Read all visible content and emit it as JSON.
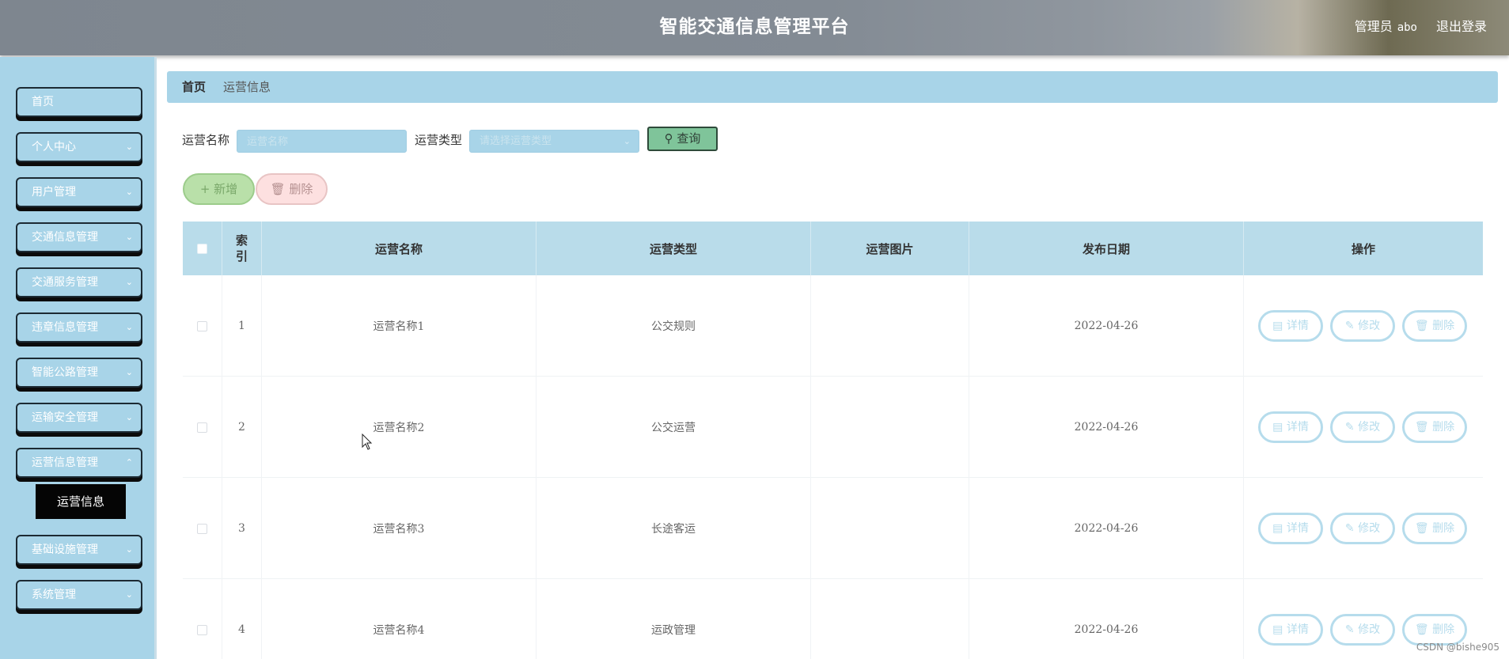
{
  "header": {
    "title": "智能交通信息管理平台",
    "user_role": "管理员",
    "username": "abo",
    "logout": "退出登录"
  },
  "sidebar": {
    "items": [
      {
        "label": "首页",
        "has_children": false
      },
      {
        "label": "个人中心",
        "has_children": true
      },
      {
        "label": "用户管理",
        "has_children": true
      },
      {
        "label": "交通信息管理",
        "has_children": true
      },
      {
        "label": "交通服务管理",
        "has_children": true
      },
      {
        "label": "违章信息管理",
        "has_children": true
      },
      {
        "label": "智能公路管理",
        "has_children": true
      },
      {
        "label": "运输安全管理",
        "has_children": true
      },
      {
        "label": "运营信息管理",
        "has_children": true
      },
      {
        "label": "基础设施管理",
        "has_children": true
      },
      {
        "label": "系统管理",
        "has_children": true
      }
    ],
    "active_sub": "运营信息"
  },
  "breadcrumb": {
    "home": "首页",
    "current": "运营信息"
  },
  "search": {
    "name_label": "运营名称",
    "name_placeholder": "运营名称",
    "type_label": "运营类型",
    "type_placeholder": "请选择运营类型",
    "query_label": "查询"
  },
  "actions": {
    "add_label": "新增",
    "delete_label": "删除"
  },
  "table": {
    "columns": [
      "索引",
      "运营名称",
      "运营类型",
      "运营图片",
      "发布日期",
      "操作"
    ],
    "rows": [
      {
        "index": "1",
        "name": "运营名称1",
        "type": "公交规则",
        "image": "",
        "date": "2022-04-26"
      },
      {
        "index": "2",
        "name": "运营名称2",
        "type": "公交运营",
        "image": "",
        "date": "2022-04-26"
      },
      {
        "index": "3",
        "name": "运营名称3",
        "type": "长途客运",
        "image": "",
        "date": "2022-04-26"
      },
      {
        "index": "4",
        "name": "运营名称4",
        "type": "运政管理",
        "image": "",
        "date": "2022-04-26"
      }
    ],
    "row_actions": {
      "detail": "详情",
      "edit": "修改",
      "delete": "删除"
    }
  },
  "watermark": "CSDN @bishe905",
  "colors": {
    "sidebar_bg": "#a8d4e8",
    "header_bg": "#838b94",
    "table_head_bg": "#b9dcea",
    "query_btn": "#7fc49a",
    "add_btn": "#b9e0a9",
    "delete_btn": "#fde0e0"
  }
}
